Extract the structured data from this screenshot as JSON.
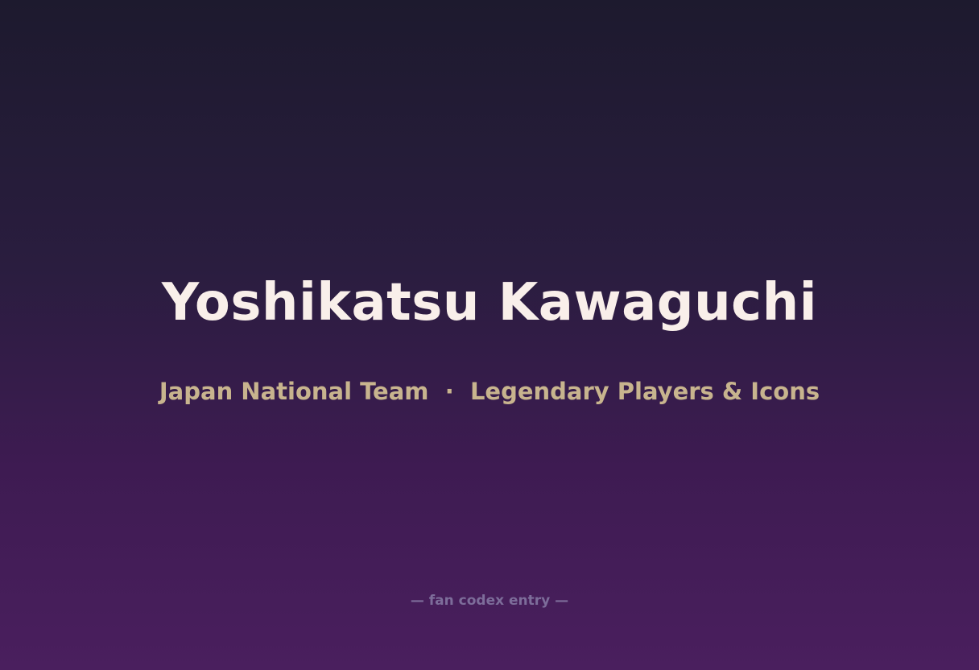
{
  "title": "Yoshikatsu Kawaguchi",
  "subtitle": {
    "team": "Japan National Team",
    "separator": "·",
    "category": "Legendary Players & Icons"
  },
  "footer": "— fan codex entry —",
  "colors": {
    "title": "#f9efea",
    "subtitle": "#c8b48e",
    "footer": "#7d6d9a",
    "background_top": "#1d1a2e",
    "background_bottom": "#4a1f5e"
  }
}
